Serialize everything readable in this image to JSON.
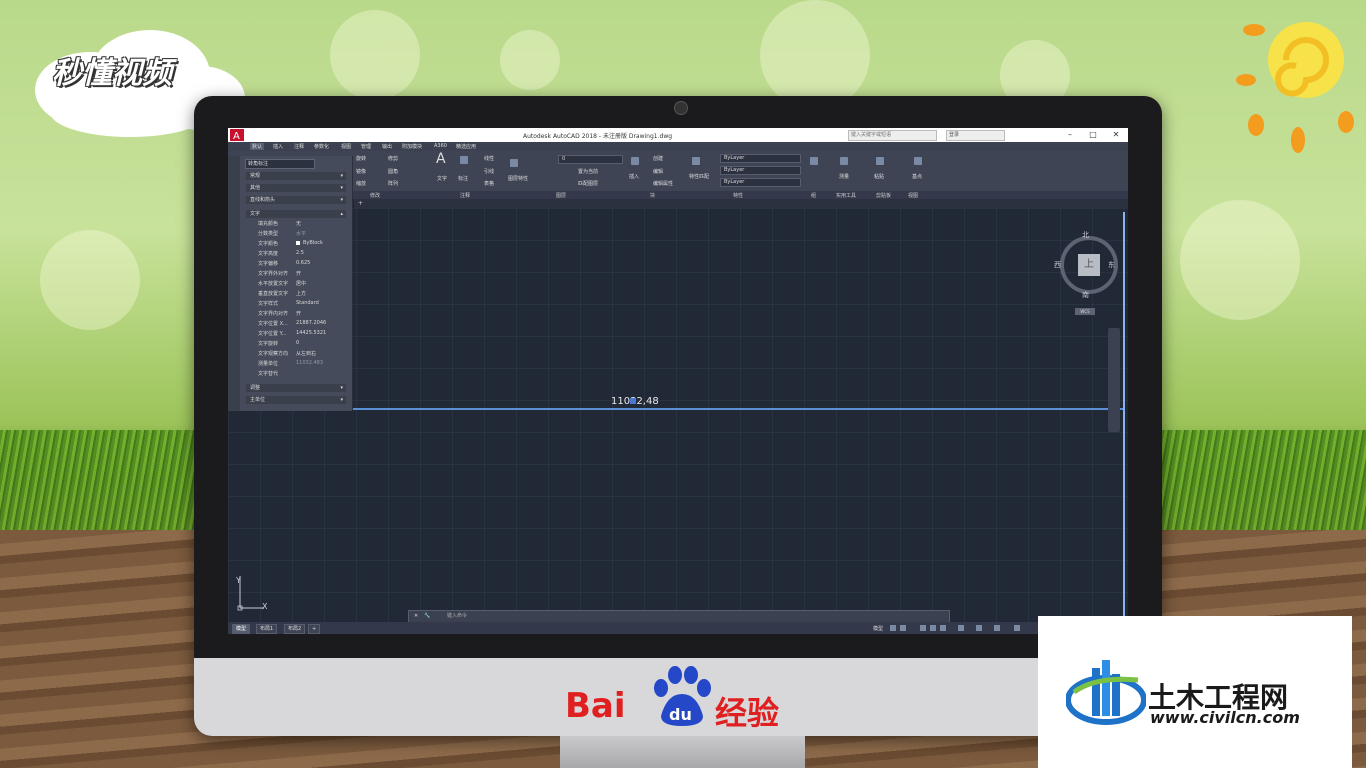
{
  "background": {
    "brand_logo_text": "秒懂视频"
  },
  "app": {
    "title": "Autodesk AutoCAD 2018 - 未注册版    Drawing1.dwg",
    "search_placeholder": "键入关键字或短语",
    "user_label": "登录",
    "menu_tabs": [
      "默认",
      "插入",
      "注释",
      "参数化",
      "视图",
      "管理",
      "输出",
      "附加模块",
      "A360",
      "精选应用"
    ],
    "active_tab": "默认",
    "ribbon_panels": [
      "修改",
      "注释",
      "图层",
      "块",
      "特性",
      "组",
      "实用工具",
      "剪贴板",
      "视图"
    ],
    "ribbon_controls": {
      "modify": [
        "旋转",
        "修剪",
        "镜像",
        "圆角",
        "缩放",
        "阵列"
      ],
      "annotation": [
        "文字",
        "标注",
        "线性",
        "引线",
        "表格"
      ],
      "layer_name": "0",
      "layer": [
        "置为当前",
        "匹配图层",
        "图层特性"
      ],
      "block": [
        "插入",
        "创建",
        "编辑",
        "编辑属性"
      ],
      "properties": [
        "特性匹配"
      ],
      "bylayer": [
        "ByLayer",
        "ByLayer",
        "ByLayer"
      ],
      "utilities": [
        "测量"
      ],
      "clipboard": [
        "粘贴"
      ],
      "view": [
        "基点"
      ]
    }
  },
  "properties_palette": {
    "selected": "转角标注",
    "categories_top": [
      "常规",
      "其他",
      "直线和箭头"
    ],
    "section": "文字",
    "rows": [
      {
        "key": "填充颜色",
        "value": "无"
      },
      {
        "key": "分数类型",
        "value": "水平"
      },
      {
        "key": "文字颜色",
        "value": "ByBlock"
      },
      {
        "key": "文字高度",
        "value": "2.5"
      },
      {
        "key": "文字偏移",
        "value": "0.625"
      },
      {
        "key": "文字界外对齐",
        "value": "开"
      },
      {
        "key": "水平放置文字",
        "value": "居中"
      },
      {
        "key": "垂直放置文字",
        "value": "上方"
      },
      {
        "key": "文字样式",
        "value": "Standard"
      },
      {
        "key": "文字界内对齐",
        "value": "开"
      },
      {
        "key": "文字位置 X...",
        "value": "21887.2046"
      },
      {
        "key": "文字位置 Y...",
        "value": "14425.5321"
      },
      {
        "key": "文字旋转",
        "value": "0"
      },
      {
        "key": "文字观察方向",
        "value": "从左到右"
      },
      {
        "key": "测量单位",
        "value": "11032.483"
      },
      {
        "key": "文字替代",
        "value": ""
      }
    ],
    "categories_bottom": [
      "调整",
      "主单位"
    ]
  },
  "drawing": {
    "dimension_text": "11032,48",
    "viewcube": {
      "top": "上",
      "north": "北",
      "south": "南",
      "east": "东",
      "west": "西",
      "wcs": "WCS"
    },
    "ucs_x": "X",
    "ucs_y": "Y",
    "command_placeholder": "键入命令"
  },
  "status_bar": {
    "layout_tabs": [
      "模型",
      "布局1",
      "布局2"
    ],
    "active_layout": "模型",
    "model_label": "模型"
  },
  "watermarks": {
    "baidu_left": "Bai",
    "baidu_du": "du",
    "baidu_right": "经验",
    "civil_cn": "土木工程网",
    "civil_url": "www.civilcn.com"
  },
  "colors": {
    "accent_blue": "#5b8fd6",
    "canvas": "#212836",
    "baidu_red": "#e02020",
    "baidu_blue": "#2448c8"
  }
}
